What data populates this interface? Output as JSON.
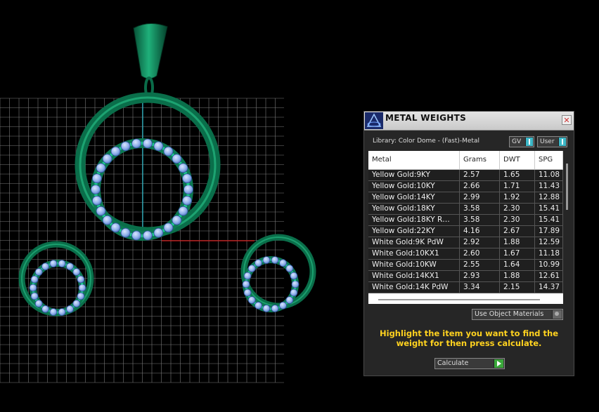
{
  "panel": {
    "title": "METAL WEIGHTS",
    "close_label": "✕",
    "library_label": "Library: Color Dome - (Fast)-Metal",
    "gv_label": "GV",
    "user_label": "User",
    "use_object_label": "Use Object Materials",
    "instruction": "Highlight the item you want to find the weight for then press calculate.",
    "calculate_label": "Calculate"
  },
  "table": {
    "columns": [
      "Metal",
      "Grams",
      "DWT",
      "SPG"
    ],
    "rows": [
      [
        "Yellow Gold:9KY",
        "2.57",
        "1.65",
        "11.08"
      ],
      [
        "Yellow Gold:10KY",
        "2.66",
        "1.71",
        "11.43"
      ],
      [
        "Yellow Gold:14KY",
        "2.99",
        "1.92",
        "12.88"
      ],
      [
        "Yellow Gold:18KY",
        "3.58",
        "2.30",
        "15.41"
      ],
      [
        "Yellow Gold:18KY R…",
        "3.58",
        "2.30",
        "15.41"
      ],
      [
        "Yellow Gold:22KY",
        "4.16",
        "2.67",
        "17.89"
      ],
      [
        "White Gold:9K PdW",
        "2.92",
        "1.88",
        "12.59"
      ],
      [
        "White Gold:10KX1",
        "2.60",
        "1.67",
        "11.18"
      ],
      [
        "White Gold:10KW",
        "2.55",
        "1.64",
        "10.99"
      ],
      [
        "White Gold:14KX1",
        "2.93",
        "1.88",
        "12.61"
      ],
      [
        "White Gold:14K PdW",
        "3.34",
        "2.15",
        "14.37"
      ]
    ]
  },
  "colors": {
    "metal_green": "#0f8a5c",
    "stone_blue": "#8fb0ea",
    "grid": "#7a7a7a",
    "axis_cyan": "#22b8c8",
    "axis_red": "#d11818",
    "instruction_yellow": "#ffd21f"
  },
  "icons": {
    "logo": "color-dome-logo-icon",
    "close": "close-icon",
    "calculate": "play-arrow-icon"
  }
}
